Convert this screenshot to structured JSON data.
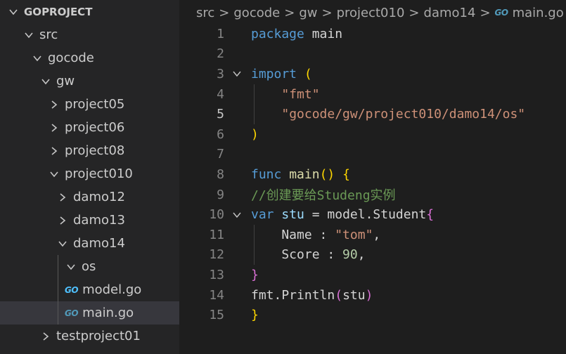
{
  "explorer": {
    "items": [
      {
        "label": "GOPROJECT",
        "expanded": true,
        "depth": 0
      },
      {
        "label": "src",
        "expanded": true,
        "depth": 1
      },
      {
        "label": "gocode",
        "expanded": true,
        "depth": 2
      },
      {
        "label": "gw",
        "expanded": true,
        "depth": 3
      },
      {
        "label": "project05",
        "expanded": false,
        "depth": 4
      },
      {
        "label": "project06",
        "expanded": false,
        "depth": 4
      },
      {
        "label": "project08",
        "expanded": false,
        "depth": 4
      },
      {
        "label": "project010",
        "expanded": true,
        "depth": 4
      },
      {
        "label": "damo12",
        "expanded": false,
        "depth": 5
      },
      {
        "label": "damo13",
        "expanded": false,
        "depth": 5
      },
      {
        "label": "damo14",
        "expanded": true,
        "depth": 5
      },
      {
        "label": "os",
        "expanded": true,
        "depth": 6
      },
      {
        "label": "model.go",
        "file": true,
        "icon": "go-file-icon",
        "depth": 6
      },
      {
        "label": "main.go",
        "file": true,
        "icon": "go-file-icon",
        "depth": 6,
        "selected": true
      },
      {
        "label": "testproject01",
        "expanded": false,
        "depth": 3
      }
    ],
    "go_icon_text": "GO"
  },
  "breadcrumb": {
    "parts": [
      "src",
      "gocode",
      "gw",
      "project010",
      "damo14"
    ],
    "file_icon_text": "GO",
    "file": "main.go",
    "separator": ">"
  },
  "editor": {
    "active_line": 5,
    "line_numbers": [
      "1",
      "2",
      "3",
      "4",
      "5",
      "6",
      "7",
      "8",
      "9",
      "10",
      "11",
      "12",
      "13",
      "14",
      "15"
    ],
    "lines": [
      [
        [
          "kw",
          "package"
        ],
        [
          "pl",
          " main"
        ]
      ],
      [],
      [
        [
          "kw",
          "import"
        ],
        [
          "pl",
          " "
        ],
        [
          "br1",
          "("
        ]
      ],
      [
        [
          "pl",
          "    "
        ],
        [
          "str",
          "\"fmt\""
        ]
      ],
      [
        [
          "pl",
          "    "
        ],
        [
          "str",
          "\"gocode/gw/project010/damo14/os\""
        ]
      ],
      [
        [
          "br1",
          ")"
        ]
      ],
      [],
      [
        [
          "kw",
          "func"
        ],
        [
          "pl",
          " "
        ],
        [
          "fn",
          "main"
        ],
        [
          "br1",
          "()"
        ],
        [
          "pl",
          " "
        ],
        [
          "br1",
          "{"
        ]
      ],
      [
        [
          "cm",
          "//创建要给Studeng实例"
        ]
      ],
      [
        [
          "kw",
          "var"
        ],
        [
          "pl",
          " "
        ],
        [
          "var",
          "stu"
        ],
        [
          "pl",
          " = "
        ],
        [
          "pl",
          "model"
        ],
        [
          "pl",
          "."
        ],
        [
          "pl",
          "Student"
        ],
        [
          "br2",
          "{"
        ]
      ],
      [
        [
          "pl",
          "    Name : "
        ],
        [
          "str",
          "\"tom\""
        ],
        [
          "pl",
          ","
        ]
      ],
      [
        [
          "pl",
          "    Score : "
        ],
        [
          "num",
          "90"
        ],
        [
          "pl",
          ","
        ]
      ],
      [
        [
          "br2",
          "}"
        ]
      ],
      [
        [
          "pl",
          "fmt.Println"
        ],
        [
          "br2",
          "("
        ],
        [
          "pl",
          "stu"
        ],
        [
          "br2",
          ")"
        ]
      ],
      [
        [
          "br1",
          "}"
        ]
      ]
    ],
    "fold_lines": [
      3,
      10
    ],
    "colors": {
      "background": "#1e1e1e",
      "keyword": "#569cd6",
      "function": "#dcdcaa",
      "string": "#ce9178",
      "number": "#b5cea8",
      "comment": "#6a9955",
      "bracket_gold": "#ffd700",
      "bracket_purple": "#da70d6"
    }
  }
}
